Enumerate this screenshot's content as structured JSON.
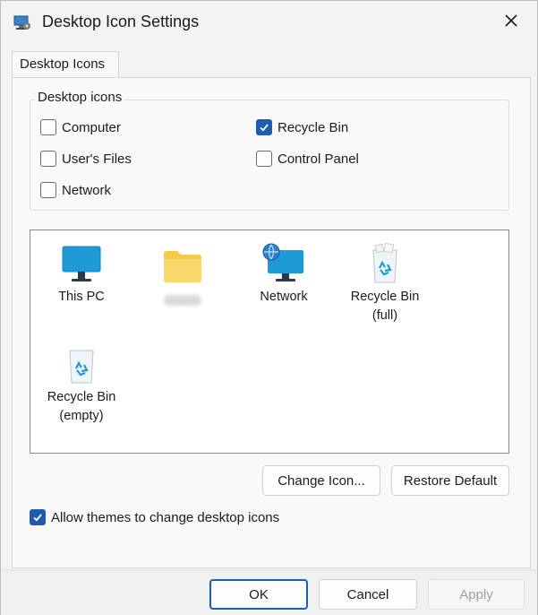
{
  "window": {
    "title": "Desktop Icon Settings",
    "icon": "desktop-settings-icon",
    "close_icon": "close-icon"
  },
  "tabs": [
    {
      "label": "Desktop Icons",
      "selected": true
    }
  ],
  "desktop_icons_group": {
    "legend": "Desktop icons",
    "checkboxes": [
      {
        "label": "Computer",
        "checked": false
      },
      {
        "label": "User's Files",
        "checked": false
      },
      {
        "label": "Network",
        "checked": false
      },
      {
        "label": "Recycle Bin",
        "checked": true
      },
      {
        "label": "Control Panel",
        "checked": false
      }
    ]
  },
  "icon_list": [
    {
      "label": "This PC",
      "icon": "monitor-icon"
    },
    {
      "label": "",
      "icon": "folder-icon",
      "label_obscured": true
    },
    {
      "label": "Network",
      "icon": "network-icon"
    },
    {
      "label": "Recycle Bin\n(full)",
      "icon": "recycle-bin-full-icon"
    },
    {
      "label": "Recycle Bin\n(empty)",
      "icon": "recycle-bin-empty-icon"
    }
  ],
  "buttons": {
    "change_icon": "Change Icon...",
    "restore_default": "Restore Default"
  },
  "allow_themes": {
    "label": "Allow themes to change desktop icons",
    "checked": true
  },
  "footer": {
    "ok": "OK",
    "cancel": "Cancel",
    "apply": "Apply"
  },
  "colors": {
    "accent": "#1f5bb3",
    "monitor": "#1e9bd7",
    "folder": "#f5c94a"
  }
}
